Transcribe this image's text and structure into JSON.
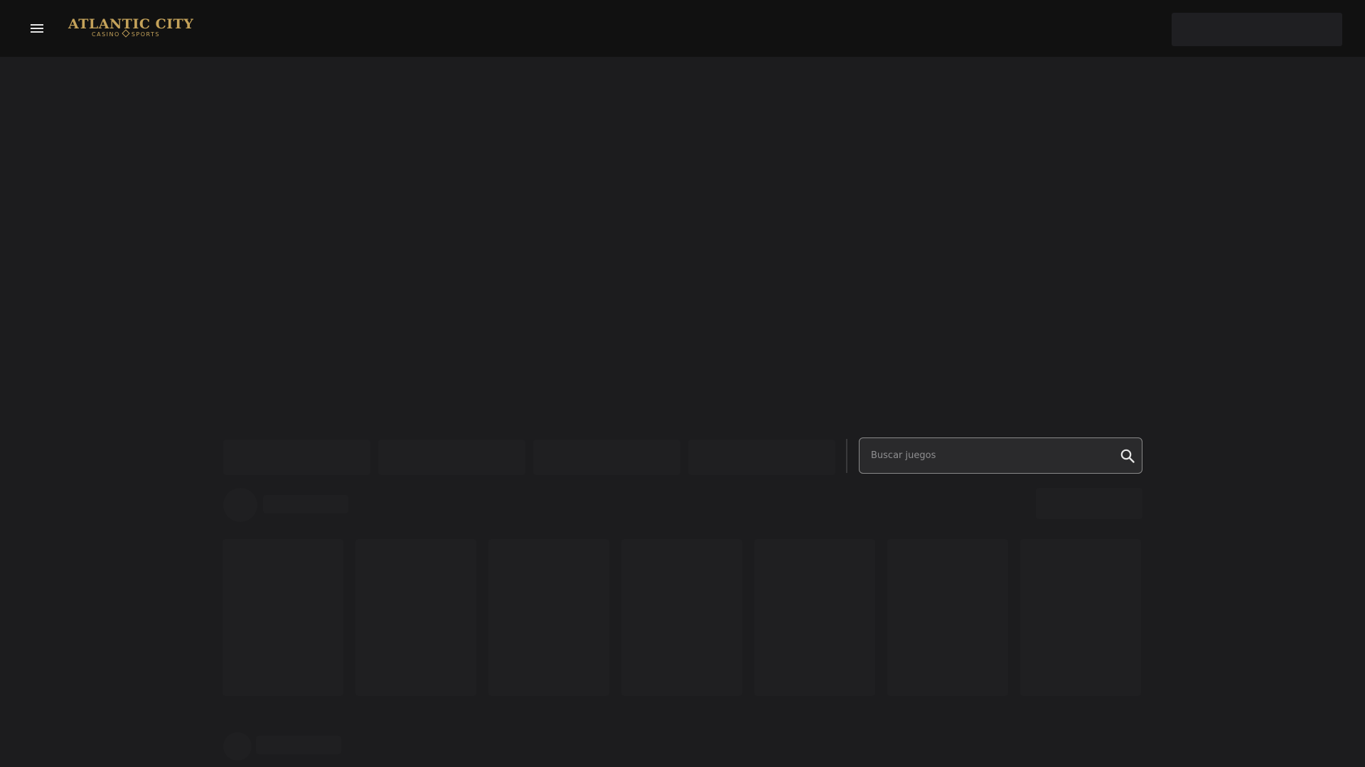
{
  "header": {
    "logo": {
      "title": "ATLANTIC CITY",
      "subtitle_left": "CASINO",
      "subtitle_right": "SPORTS"
    },
    "menu_icon": "hamburger-menu-icon"
  },
  "search": {
    "placeholder": "Buscar juegos",
    "value": "",
    "icon": "search-icon"
  },
  "colors": {
    "page_background": "#1c1c1e",
    "header_background": "#111111",
    "brand_gold": "#c4a25a",
    "skeleton": "#1f1f21"
  }
}
